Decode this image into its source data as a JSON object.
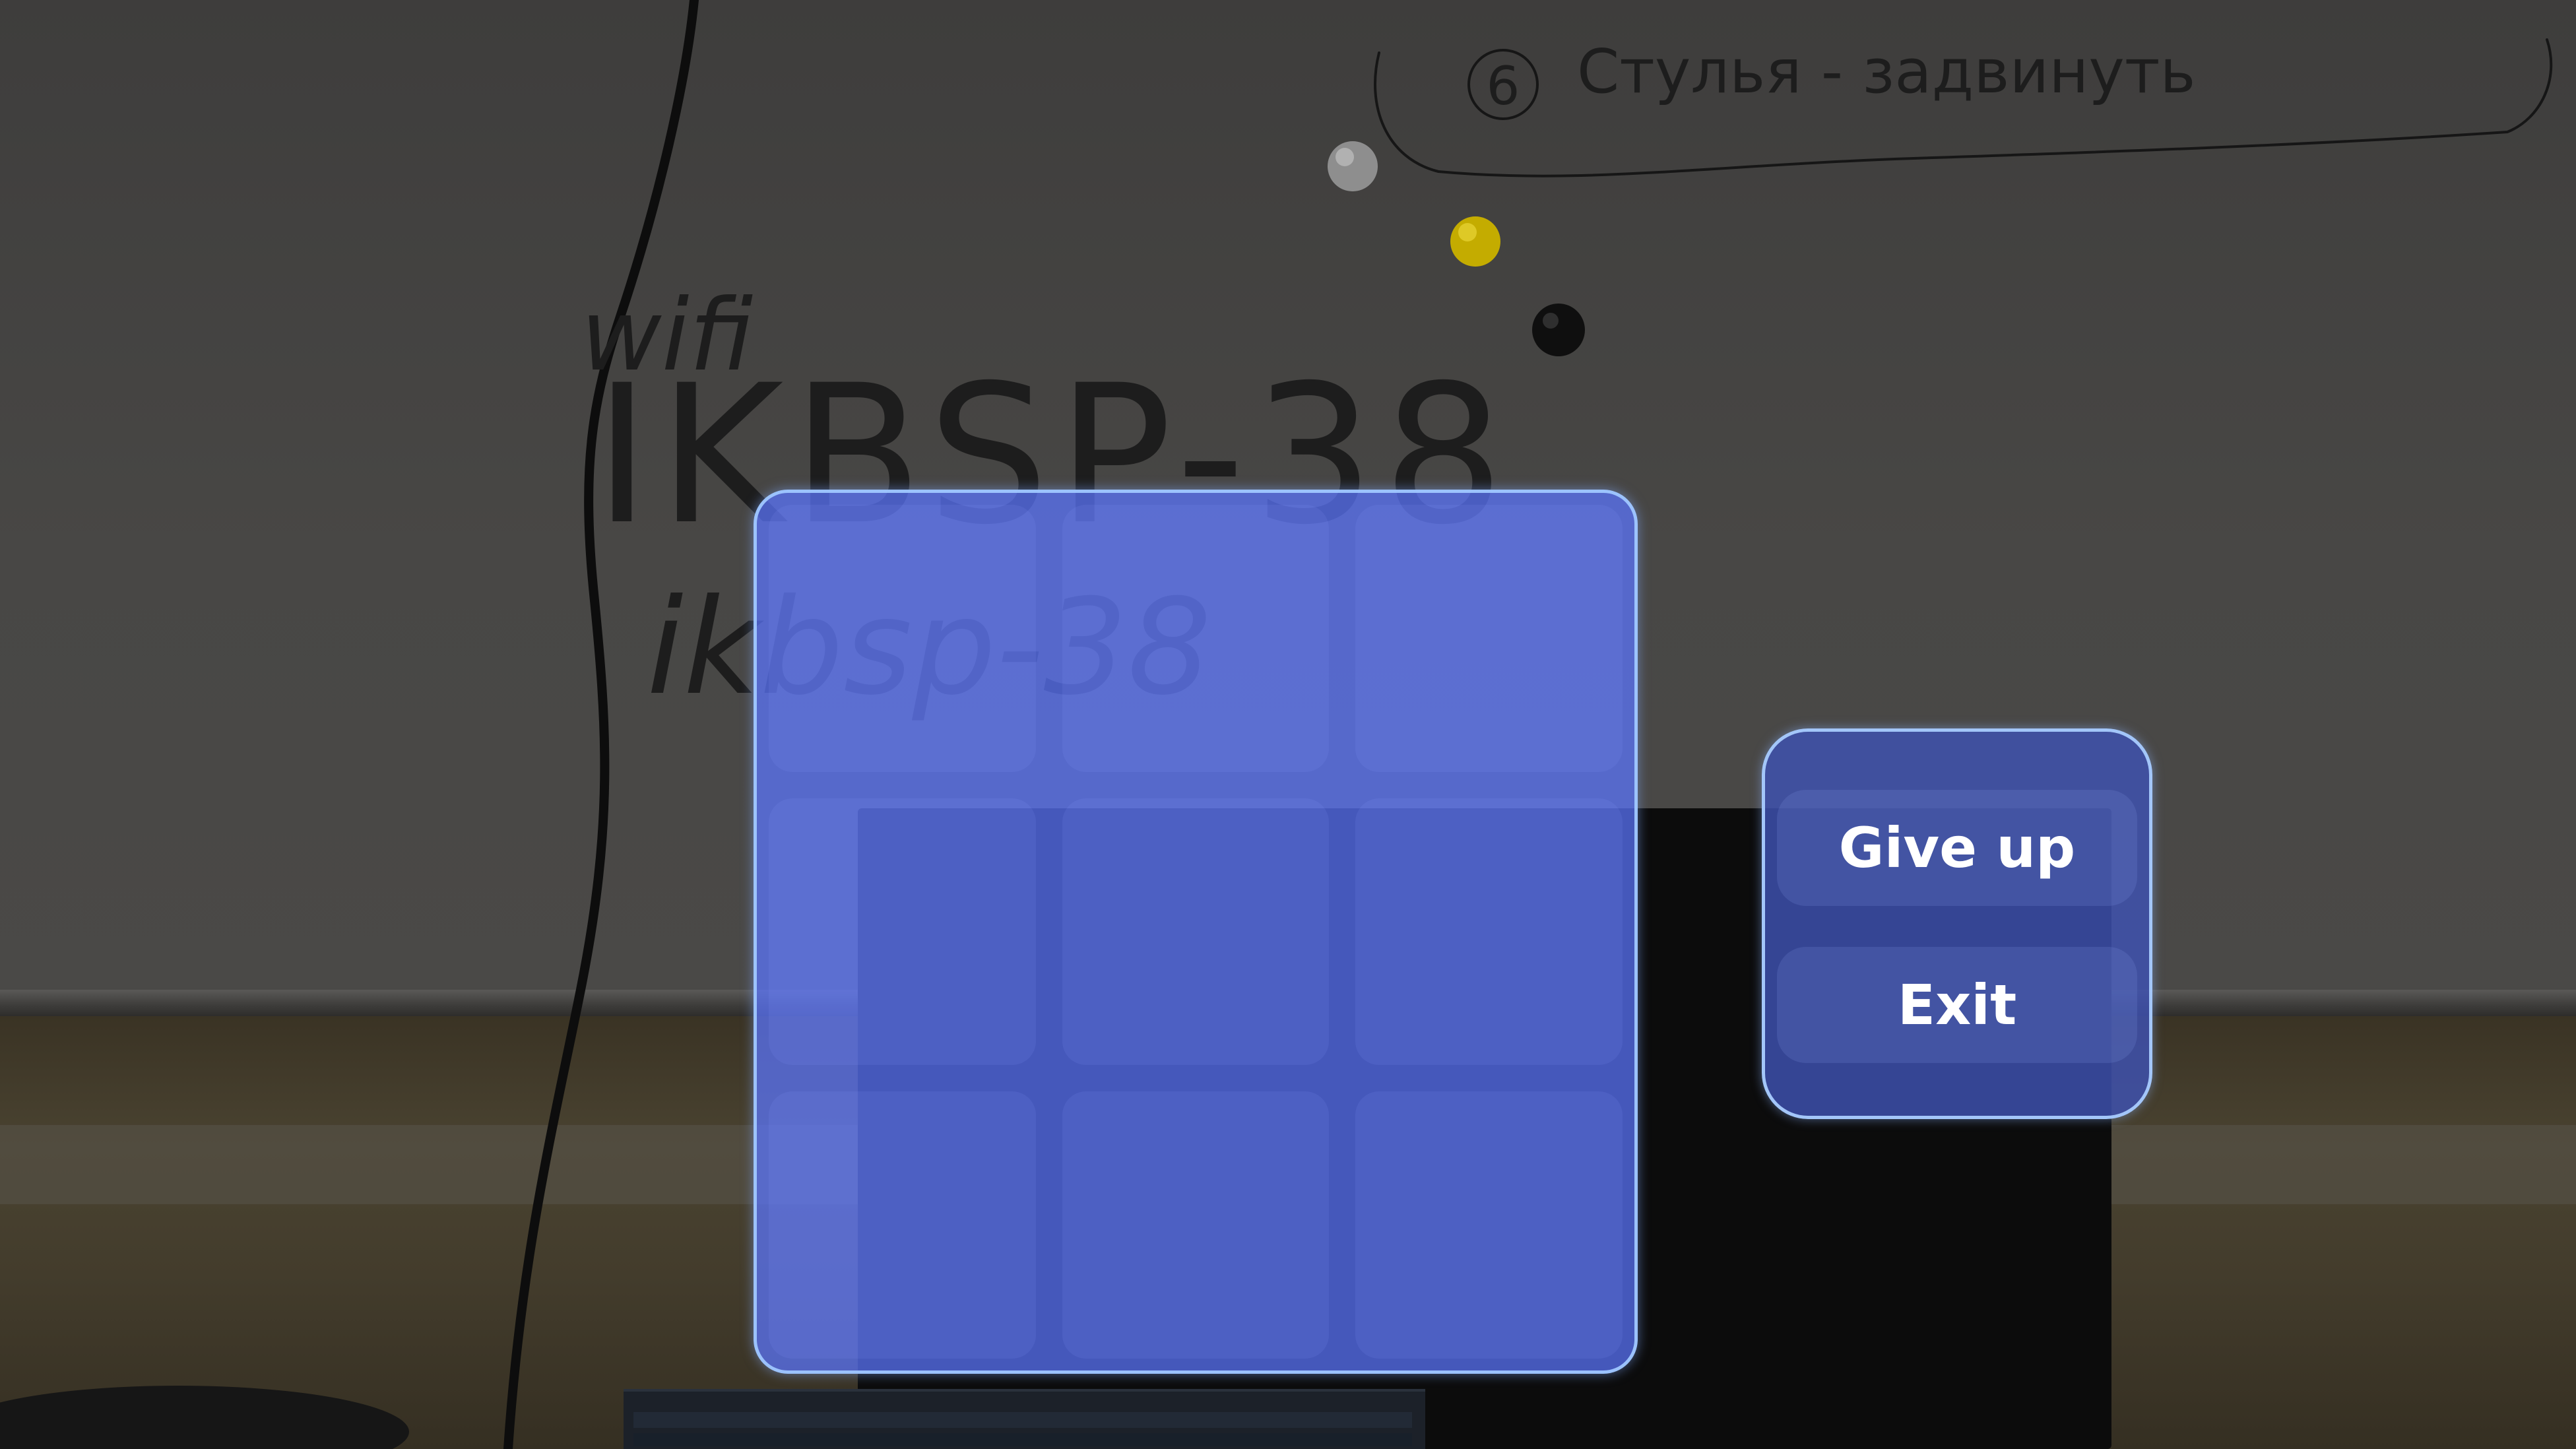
{
  "background": {
    "whiteboard_text": {
      "top_note": "Стулья - задвинуть",
      "top_note_number": "6",
      "wifi_label": "wifi",
      "ssid": "IKBSP-38",
      "password": "ikbsp-38"
    },
    "magnets": [
      {
        "name": "gray-magnet",
        "color": "#9a9a9a"
      },
      {
        "name": "yellow-magnet",
        "color": "#c9b000"
      },
      {
        "name": "black-magnet",
        "color": "#111111"
      }
    ]
  },
  "game_board": {
    "accent_color": "#5c76ff",
    "border_color": "#a0c8ff",
    "cells": [
      {
        "row": 1,
        "col": 1,
        "mark": ""
      },
      {
        "row": 1,
        "col": 2,
        "mark": ""
      },
      {
        "row": 1,
        "col": 3,
        "mark": ""
      },
      {
        "row": 2,
        "col": 1,
        "mark": ""
      },
      {
        "row": 2,
        "col": 2,
        "mark": ""
      },
      {
        "row": 2,
        "col": 3,
        "mark": ""
      },
      {
        "row": 3,
        "col": 1,
        "mark": ""
      },
      {
        "row": 3,
        "col": 2,
        "mark": ""
      },
      {
        "row": 3,
        "col": 3,
        "mark": ""
      }
    ]
  },
  "menu": {
    "give_up_label": "Give up",
    "exit_label": "Exit"
  }
}
